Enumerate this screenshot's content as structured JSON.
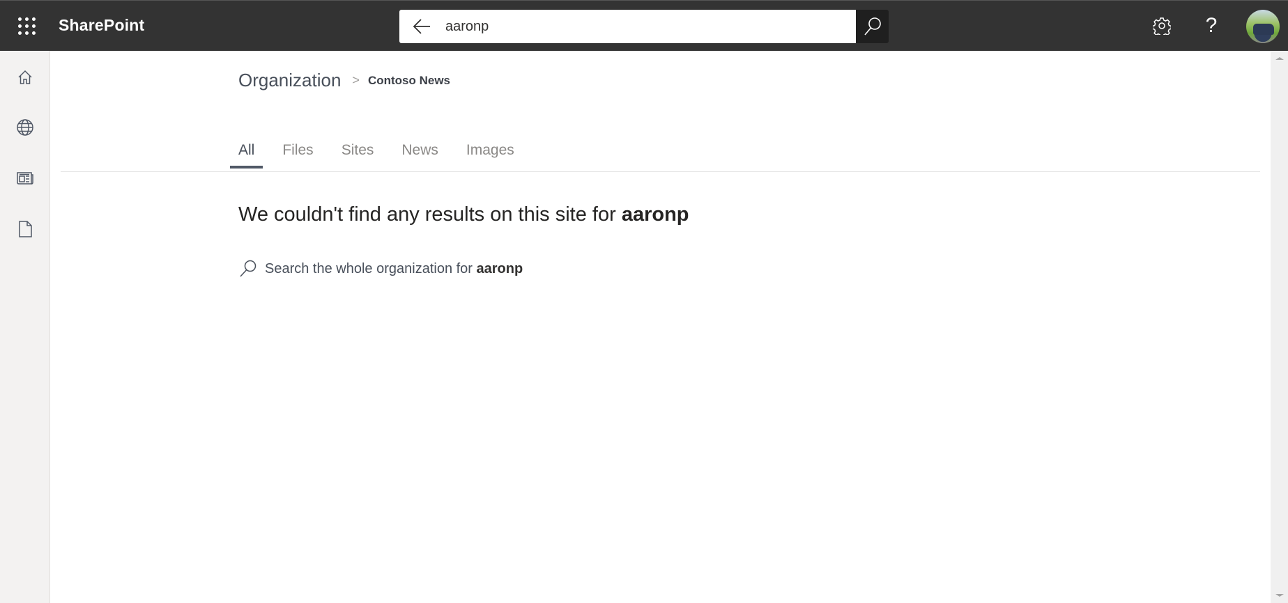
{
  "header": {
    "app_launcher_icon": "waffle-icon",
    "brand": "SharePoint",
    "search": {
      "value": "aaronp",
      "placeholder": "",
      "back_icon": "arrow-left-icon",
      "submit_icon": "search-icon"
    },
    "settings_icon": "gear-icon",
    "help_label": "?",
    "avatar_alt": "User profile photo"
  },
  "sidebar": {
    "items": [
      {
        "name": "home",
        "icon": "home-icon"
      },
      {
        "name": "sites",
        "icon": "globe-icon"
      },
      {
        "name": "news",
        "icon": "news-icon"
      },
      {
        "name": "files",
        "icon": "document-icon"
      }
    ]
  },
  "breadcrumb": {
    "root": "Organization",
    "separator": ">",
    "current": "Contoso News"
  },
  "tabs": [
    {
      "label": "All",
      "active": true
    },
    {
      "label": "Files",
      "active": false
    },
    {
      "label": "Sites",
      "active": false
    },
    {
      "label": "News",
      "active": false
    },
    {
      "label": "Images",
      "active": false
    }
  ],
  "results": {
    "no_results_prefix": "We couldn't find any results on this site for ",
    "query": "aaronp",
    "org_search_prefix": "Search the whole organization for ",
    "org_search_query": "aaronp"
  }
}
